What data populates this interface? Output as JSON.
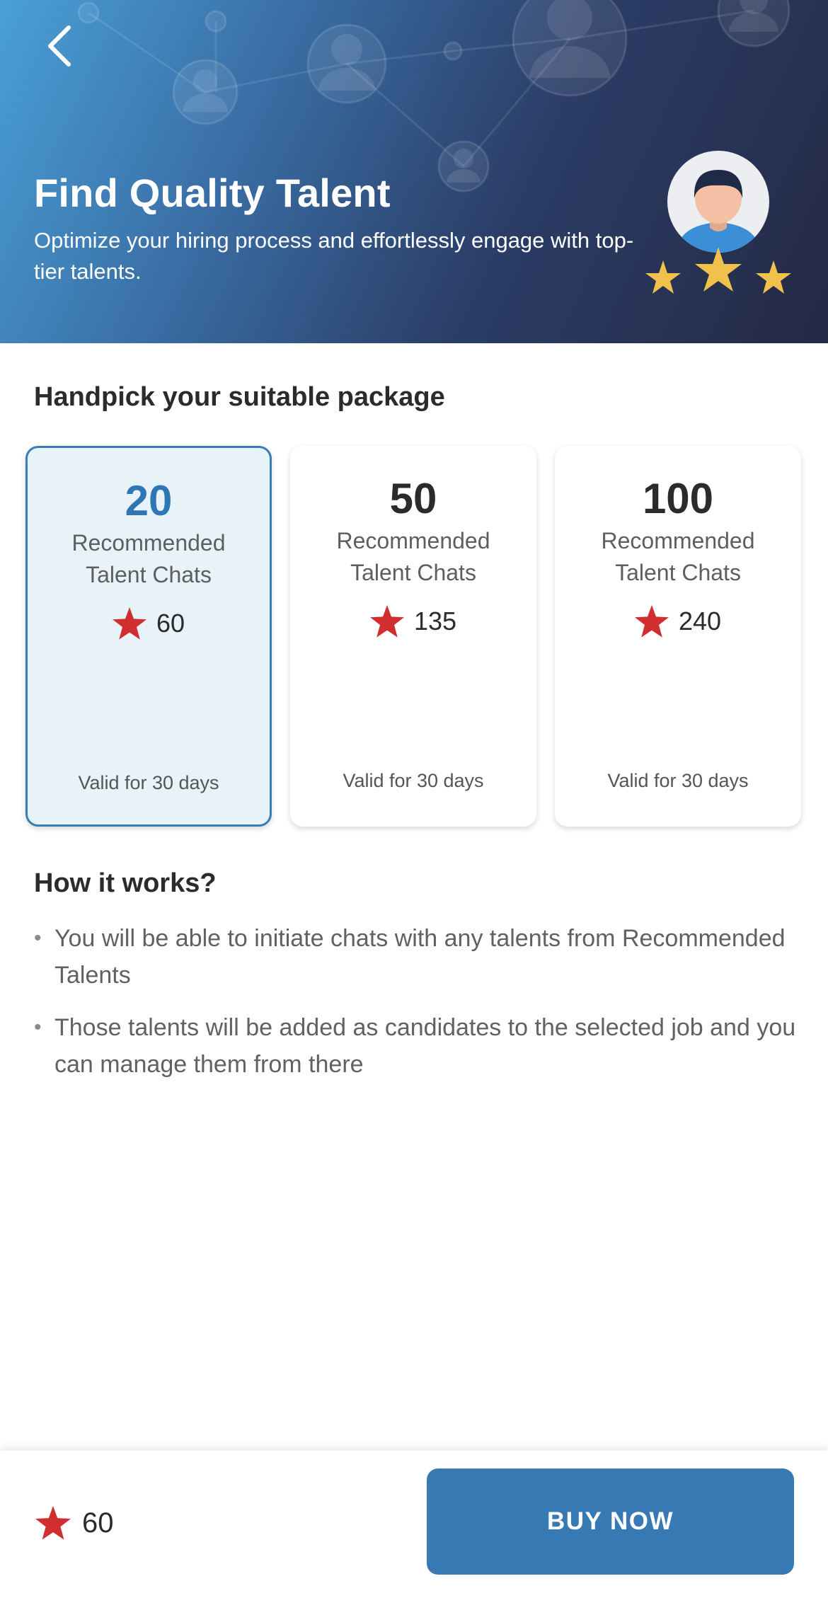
{
  "header": {
    "title": "Find Quality Talent",
    "subtitle": "Optimize your hiring process and effortlessly engage with top-tier talents.",
    "back_icon": "chevron-left-icon",
    "illustration_icon": "talent-avatar-with-stars-icon"
  },
  "packages": {
    "section_title": "Handpick your suitable package",
    "items": [
      {
        "count": "20",
        "description_line1": "Recommended",
        "description_line2": "Talent Chats",
        "price": "60",
        "validity": "Valid for 30 days",
        "selected": true
      },
      {
        "count": "50",
        "description_line1": "Recommended",
        "description_line2": "Talent Chats",
        "price": "135",
        "validity": "Valid for 30 days",
        "selected": false
      },
      {
        "count": "100",
        "description_line1": "Recommended",
        "description_line2": "Talent Chats",
        "price": "240",
        "validity": "Valid for 30 days",
        "selected": false
      }
    ]
  },
  "how_it_works": {
    "title": "How it works?",
    "items": [
      "You will be able to initiate chats with any talents from Recommended Talents",
      "Those talents will be added as candidates to the selected job and you can manage them from there"
    ]
  },
  "footer": {
    "balance": "60",
    "buy_label": "BUY NOW"
  },
  "colors": {
    "accent": "#3679b3",
    "selected_bg": "#e8f2f9",
    "star": "#d12f2f",
    "gold_star": "#f1c24b"
  }
}
